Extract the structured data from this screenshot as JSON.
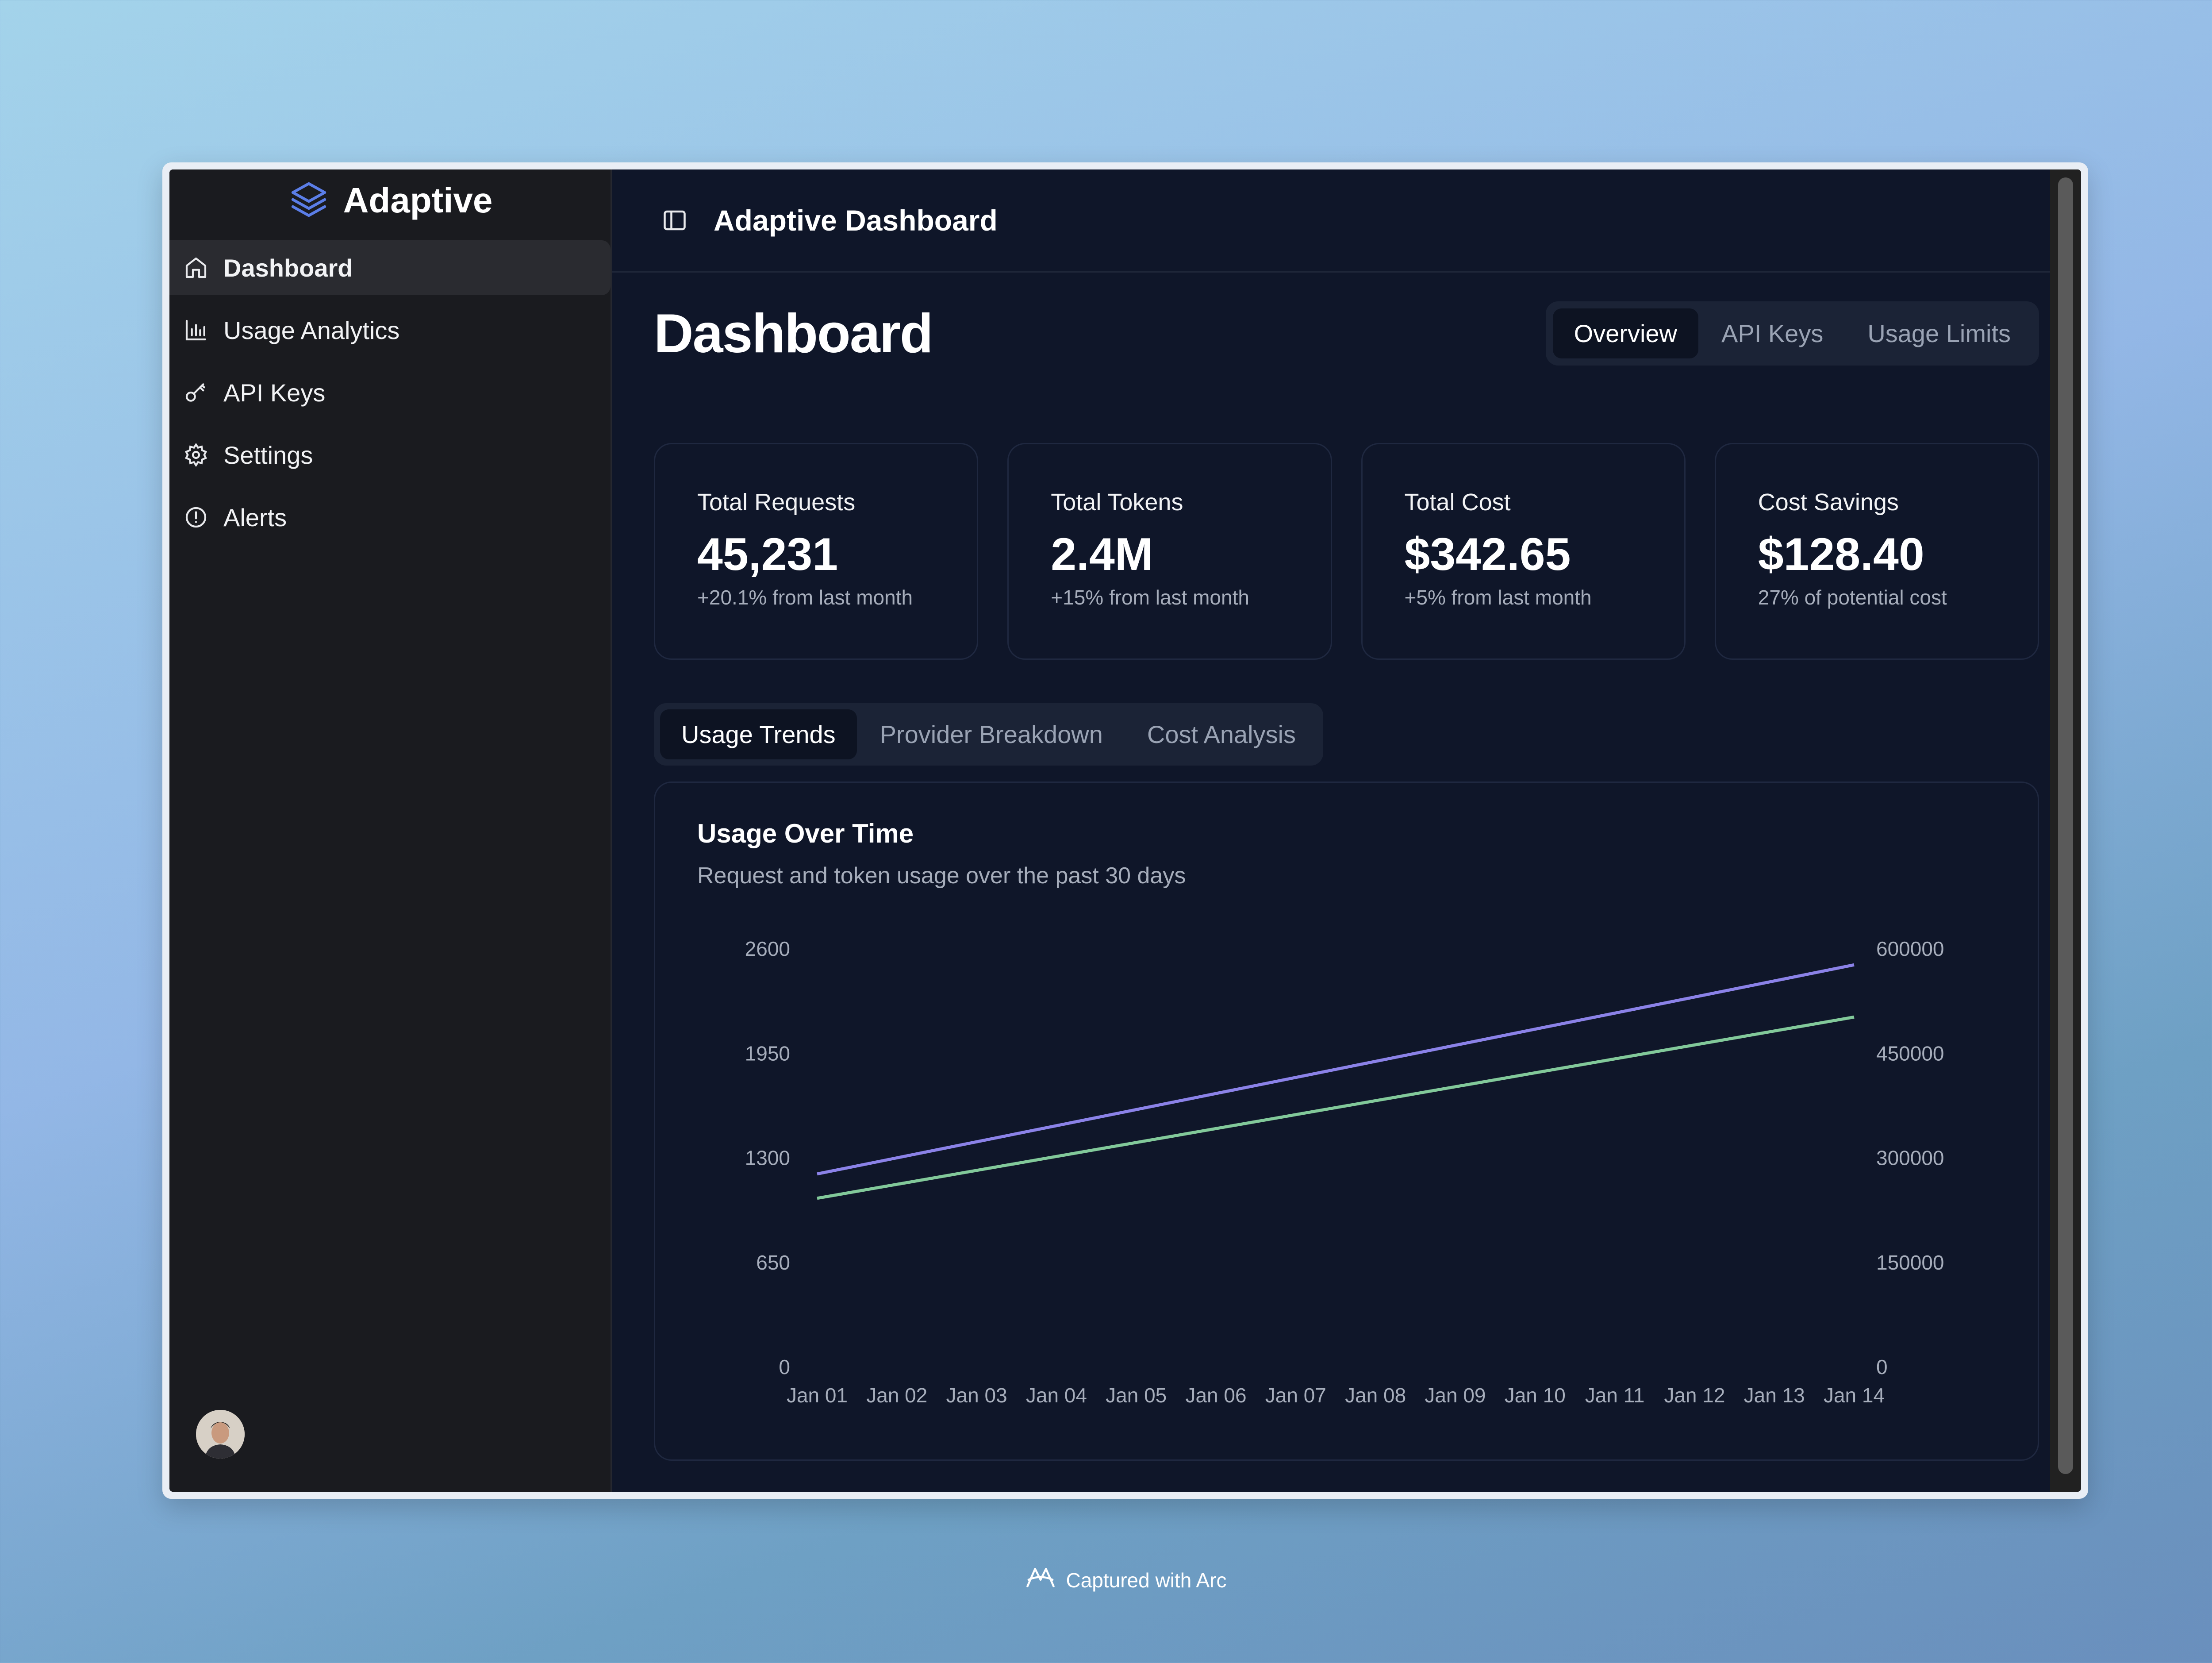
{
  "sidebar": {
    "brand": "Adaptive",
    "items": [
      {
        "label": "Dashboard",
        "icon": "home-icon",
        "active": true
      },
      {
        "label": "Usage Analytics",
        "icon": "bar-chart-icon",
        "active": false
      },
      {
        "label": "API Keys",
        "icon": "key-icon",
        "active": false
      },
      {
        "label": "Settings",
        "icon": "gear-icon",
        "active": false
      },
      {
        "label": "Alerts",
        "icon": "alert-circle-icon",
        "active": false
      }
    ]
  },
  "topbar": {
    "title": "Adaptive Dashboard"
  },
  "page": {
    "title": "Dashboard",
    "tabs": [
      {
        "label": "Overview",
        "active": true
      },
      {
        "label": "API Keys",
        "active": false
      },
      {
        "label": "Usage Limits",
        "active": false
      }
    ]
  },
  "stats": [
    {
      "title": "Total Requests",
      "value": "45,231",
      "sub": "+20.1% from last month"
    },
    {
      "title": "Total Tokens",
      "value": "2.4M",
      "sub": "+15% from last month"
    },
    {
      "title": "Total Cost",
      "value": "$342.65",
      "sub": "+5% from last month"
    },
    {
      "title": "Cost Savings",
      "value": "$128.40",
      "sub": "27% of potential cost"
    }
  ],
  "subtabs": [
    {
      "label": "Usage Trends",
      "active": true
    },
    {
      "label": "Provider Breakdown",
      "active": false
    },
    {
      "label": "Cost Analysis",
      "active": false
    }
  ],
  "chart": {
    "title": "Usage Over Time",
    "subtitle": "Request and token usage over the past 30 days"
  },
  "chart_data": {
    "type": "line",
    "x": [
      "Jan 01",
      "Jan 02",
      "Jan 03",
      "Jan 04",
      "Jan 05",
      "Jan 06",
      "Jan 07",
      "Jan 08",
      "Jan 09",
      "Jan 10",
      "Jan 11",
      "Jan 12",
      "Jan 13",
      "Jan 14"
    ],
    "y_left": {
      "ticks": [
        0,
        650,
        1300,
        1950,
        2600
      ],
      "range": [
        0,
        2600
      ]
    },
    "y_right": {
      "ticks": [
        0,
        150000,
        300000,
        450000,
        600000
      ],
      "range": [
        0,
        600000
      ]
    },
    "series": [
      {
        "axis": "left",
        "color": "#8b82e8",
        "values": [
          1200,
          1300,
          1400,
          1500,
          1600,
          1700,
          1800,
          1900,
          2000,
          2100,
          2200,
          2300,
          2400,
          2500
        ]
      },
      {
        "axis": "right",
        "color": "#82c99a",
        "values": [
          242000,
          262000,
          282000,
          302000,
          322000,
          342000,
          362000,
          382000,
          402000,
          422000,
          442000,
          462000,
          482000,
          502000
        ]
      }
    ],
    "grid": false,
    "legend": "none"
  },
  "user": {
    "avatar": "avatar-icon"
  },
  "footer": {
    "caption": "Captured with Arc"
  }
}
